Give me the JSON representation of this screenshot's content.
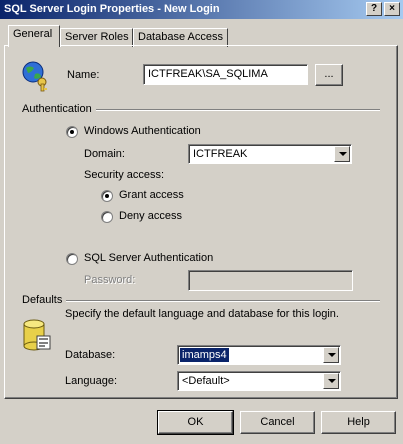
{
  "window": {
    "title": "SQL Server Login Properties - New Login",
    "help_btn": "?",
    "close_btn": "×"
  },
  "tabs": [
    {
      "label": "General",
      "active": true
    },
    {
      "label": "Server Roles",
      "active": false
    },
    {
      "label": "Database Access",
      "active": false
    }
  ],
  "general": {
    "name_label": "Name:",
    "name_value": "ICTFREAK\\SA_SQLIMA",
    "browse_btn": "...",
    "auth_group": "Authentication",
    "windows_auth": {
      "label": "Windows Authentication",
      "selected": true
    },
    "domain_label": "Domain:",
    "domain_value": "ICTFREAK",
    "security_access_label": "Security access:",
    "grant_access": {
      "label": "Grant access",
      "selected": true
    },
    "deny_access": {
      "label": "Deny access",
      "selected": false
    },
    "sql_auth": {
      "label": "SQL Server Authentication",
      "selected": false
    },
    "password_label": "Password:",
    "password_value": "",
    "defaults_group": "Defaults",
    "defaults_desc": "Specify the default language and database for this login.",
    "database_label": "Database:",
    "database_value": "imamps4",
    "language_label": "Language:",
    "language_value": "<Default>"
  },
  "buttons": {
    "ok": "OK",
    "cancel": "Cancel",
    "help": "Help"
  }
}
